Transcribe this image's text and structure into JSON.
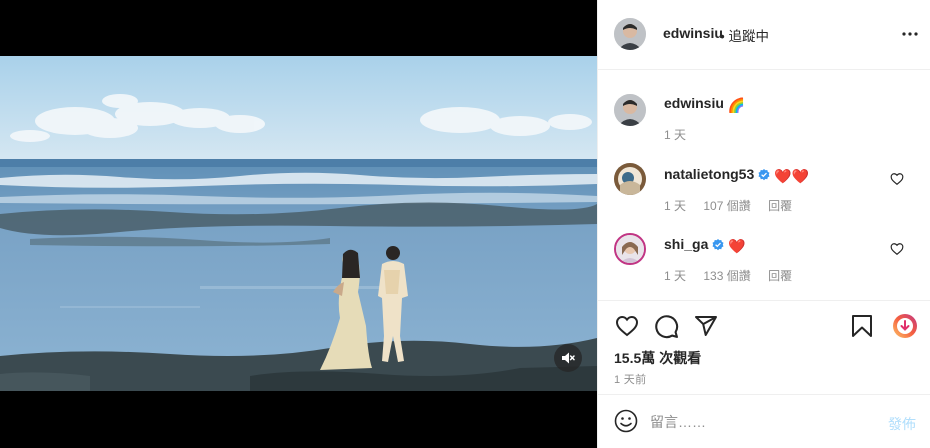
{
  "post": {
    "author": "edwinsiu",
    "follow_status": "• 追蹤中",
    "caption_emoji": "🌈",
    "caption_time": "1 天",
    "views_count": "15.5萬",
    "views_label": "次觀看",
    "posted_ago": "1 天前"
  },
  "comments": [
    {
      "username": "natalietong53",
      "verified": true,
      "emoji": "❤️❤️",
      "time": "1 天",
      "likes": "107 個讚",
      "reply_label": "回覆"
    },
    {
      "username": "shi_ga",
      "verified": true,
      "emoji": "❤️",
      "time": "1 天",
      "likes": "133 個讚",
      "reply_label": "回覆"
    }
  ],
  "composer": {
    "placeholder": "留言……",
    "post_label": "發佈"
  },
  "icons": {
    "more": "more-horizontal-icon",
    "mute": "muted-speaker-icon",
    "like": "heart-icon",
    "comment": "comment-bubble-icon",
    "share": "paper-plane-icon",
    "save": "bookmark-icon",
    "promo": "gradient-download-badge-icon",
    "emoji": "smiley-icon",
    "verified": "verified-badge-icon"
  },
  "colors": {
    "verified": "#3897f0",
    "heart": "#ed4956",
    "post_disabled": "#b2dffc",
    "meta_text": "#8e8e8e"
  }
}
